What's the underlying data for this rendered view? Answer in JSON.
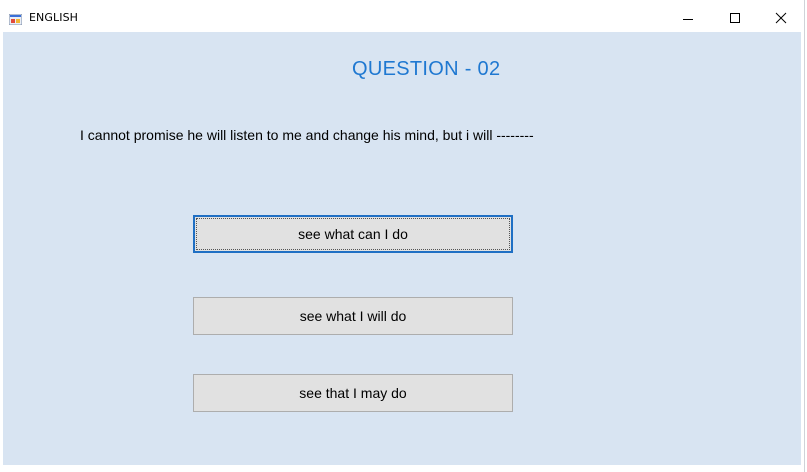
{
  "window": {
    "title": "ENGLISH",
    "controls": {
      "minimize_icon": "minimize-icon",
      "maximize_icon": "maximize-icon",
      "close_icon": "close-icon"
    }
  },
  "content": {
    "heading": "QUESTION - 02",
    "question": "I cannot promise he will listen to me and change his mind, but i will --------",
    "answers": [
      {
        "label": "see what can I do",
        "focused": true
      },
      {
        "label": "see what I will do",
        "focused": false
      },
      {
        "label": "see that I may do",
        "focused": false
      }
    ]
  },
  "colors": {
    "client_background": "#d8e4f2",
    "heading": "#1f78d1",
    "button_face": "#e1e1e1",
    "focus_border": "#1f6fc4"
  }
}
